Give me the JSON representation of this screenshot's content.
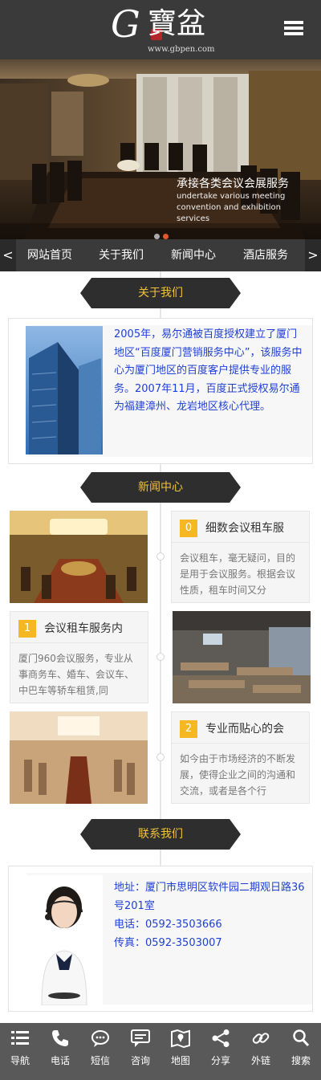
{
  "header": {
    "logo_initial": "G",
    "logo_name": "寶盆",
    "logo_url": "www.gbpen.com",
    "menu_icon": "hamburger-icon"
  },
  "banner": {
    "caption_cn": "承接各类会议会展服务",
    "caption_en": "undertake various meeting convention and exhibition services",
    "slides": 2,
    "active_slide": 2
  },
  "nav": {
    "items": [
      "网站首页",
      "关于我们",
      "新闻中心",
      "酒店服务"
    ],
    "prev": "<",
    "next": ">"
  },
  "about": {
    "heading": "关于我们",
    "text": "2005年，易尔通被百度授权建立了厦门地区“百度厦门营销服务中心”，该服务中心为厦门地区的百度客户提供专业的服务。2007年11月，百度正式授权易尔通为福建漳州、龙岩地区核心代理。"
  },
  "news": {
    "heading": "新闻中心",
    "items": [
      {
        "num": "0",
        "title": "细数会议租车服",
        "desc": "会议租车，毫无疑问，目的是用于会议服务。根据会议性质，租车时间又分"
      },
      {
        "num": "1",
        "title": "会议租车服务内",
        "desc": "厦门960会议服务，专业从事商务车、婚车、会议车、中巴车等轿车租赁,同"
      },
      {
        "num": "2",
        "title": "专业而贴心的会",
        "desc": "如今由于市场经济的不断发展，使得企业之间的沟通和交流，或者是各个行"
      }
    ]
  },
  "contact": {
    "heading": "联系我们",
    "address": "地址：厦门市思明区软件园二期观日路36号201室",
    "phone": "电话：0592-3503666",
    "fax": "传真：0592-3503007"
  },
  "bottom_bar": [
    {
      "label": "导航",
      "icon": "list-icon"
    },
    {
      "label": "电话",
      "icon": "phone-icon"
    },
    {
      "label": "短信",
      "icon": "sms-icon"
    },
    {
      "label": "咨询",
      "icon": "chat-icon"
    },
    {
      "label": "地图",
      "icon": "map-icon"
    },
    {
      "label": "分享",
      "icon": "share-icon"
    },
    {
      "label": "外链",
      "icon": "link-icon"
    },
    {
      "label": "搜索",
      "icon": "search-icon"
    }
  ],
  "colors": {
    "header_bg": "#3a3a3a",
    "heading_text": "#f2c23a",
    "body_link": "#1f3fd6",
    "badge": "#f5b722",
    "bottom_bar": "#595959"
  }
}
